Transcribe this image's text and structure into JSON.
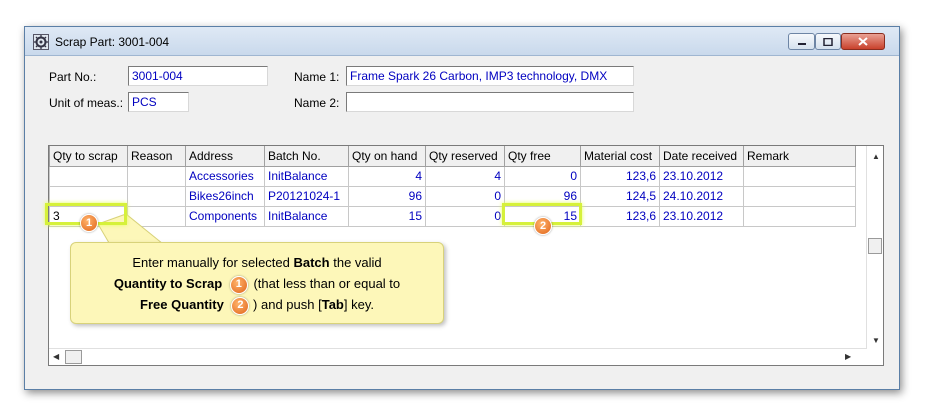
{
  "window": {
    "title": "Scrap Part: 3001-004",
    "icons": {
      "app": "gear-icon",
      "minimize": "minimize-icon",
      "maximize": "maximize-icon",
      "close": "close-icon"
    }
  },
  "form": {
    "part_no_label": "Part No.:",
    "part_no_value": "3001-004",
    "unit_label": "Unit of meas.:",
    "unit_value": "PCS",
    "name1_label": "Name 1:",
    "name1_value": "Frame Spark 26 Carbon, IMP3 technology, DMX",
    "name2_label": "Name 2:",
    "name2_value": ""
  },
  "grid": {
    "columns": [
      "Qty to scrap",
      "Reason",
      "Address",
      "Batch No.",
      "Qty on hand",
      "Qty reserved",
      "Qty free",
      "Material cost",
      "Date received",
      "Remark"
    ],
    "rows": [
      {
        "qty_to_scrap": "",
        "reason": "",
        "address": "Accessories",
        "batch": "InitBalance",
        "on_hand": "4",
        "reserved": "4",
        "free": "0",
        "cost": "123,6",
        "date": "23.10.2012",
        "remark": ""
      },
      {
        "qty_to_scrap": "",
        "reason": "",
        "address": "Bikes26inch",
        "batch": "P20121024-1",
        "on_hand": "96",
        "reserved": "0",
        "free": "96",
        "cost": "124,5",
        "date": "24.10.2012",
        "remark": ""
      },
      {
        "qty_to_scrap": "3",
        "reason": "",
        "address": "Components",
        "batch": "InitBalance",
        "on_hand": "15",
        "reserved": "0",
        "free": "15",
        "cost": "123,6",
        "date": "23.10.2012",
        "remark": ""
      }
    ]
  },
  "annotations": {
    "badge1": "1",
    "badge2": "2",
    "callout": {
      "l1": "Enter manually for selected ",
      "l1b": "Batch",
      "l1c": " the valid",
      "l2b": "Quantity to Scrap",
      "l2c": " (that less than or equal to",
      "l3b": "Free Quantity",
      "l3c": " ) and push [",
      "l3d": "Tab",
      "l3e": "] key."
    },
    "colors": {
      "highlight": "#d6f13a",
      "badge": "#e0641a",
      "callout_bg": "#fdf7b9"
    }
  }
}
